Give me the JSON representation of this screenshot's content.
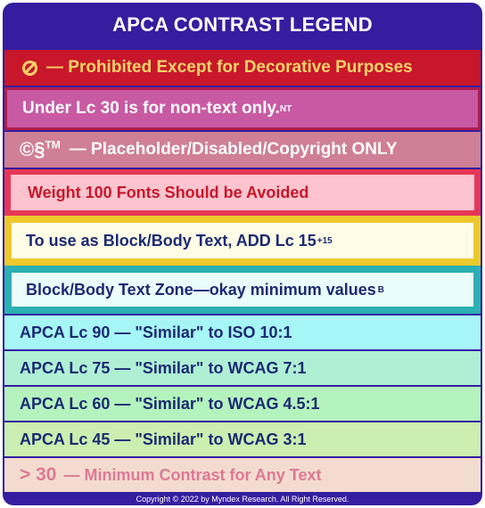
{
  "title": "APCA CONTRAST LEGEND",
  "rows": [
    {
      "symbol": "prohibited-icon",
      "text": "— Prohibited Except for Decorative Purposes"
    },
    {
      "text": "Under Lc 30 is for non-text only.",
      "sup": "NT"
    },
    {
      "symbol_text": "©§",
      "symbol_sup": "TM",
      "text": "— Placeholder/Disabled/Copyright ONLY"
    },
    {
      "text": "Weight 100 Fonts Should be Avoided"
    },
    {
      "text": "To use as Block/Body Text, ADD Lc 15",
      "sup": "+15"
    },
    {
      "text": "Block/Body Text Zone—okay minimum values",
      "sup": "B"
    },
    {
      "text": "APCA Lc 90 — \"Similar\" to ISO 10:1"
    },
    {
      "text": "APCA Lc 75 — \"Similar\" to WCAG 7:1"
    },
    {
      "text": "APCA Lc 60 — \"Similar\" to WCAG 4.5:1"
    },
    {
      "text": "APCA Lc 45 — \"Similar\" to WCAG 3:1"
    },
    {
      "symbol_text": "> 30",
      "text": "— Minimum Contrast for Any Text"
    }
  ],
  "footer": "Copyright © 2022 by Myndex Research. All Right Reserved.",
  "colors": {
    "frame": "#351da0",
    "prohibited": "#c8172a",
    "non_text": "#c85aa3",
    "placeholder": "#cf7f96",
    "weight100": "#fcc4cf",
    "add15_border": "#edc92c",
    "body_zone_border": "#2bb0b3",
    "lc90": "#a7f6f6",
    "lc75": "#aff0d5",
    "lc60": "#b5f3be",
    "lc45": "#cbefb0",
    "min30": "#f3dccf"
  }
}
